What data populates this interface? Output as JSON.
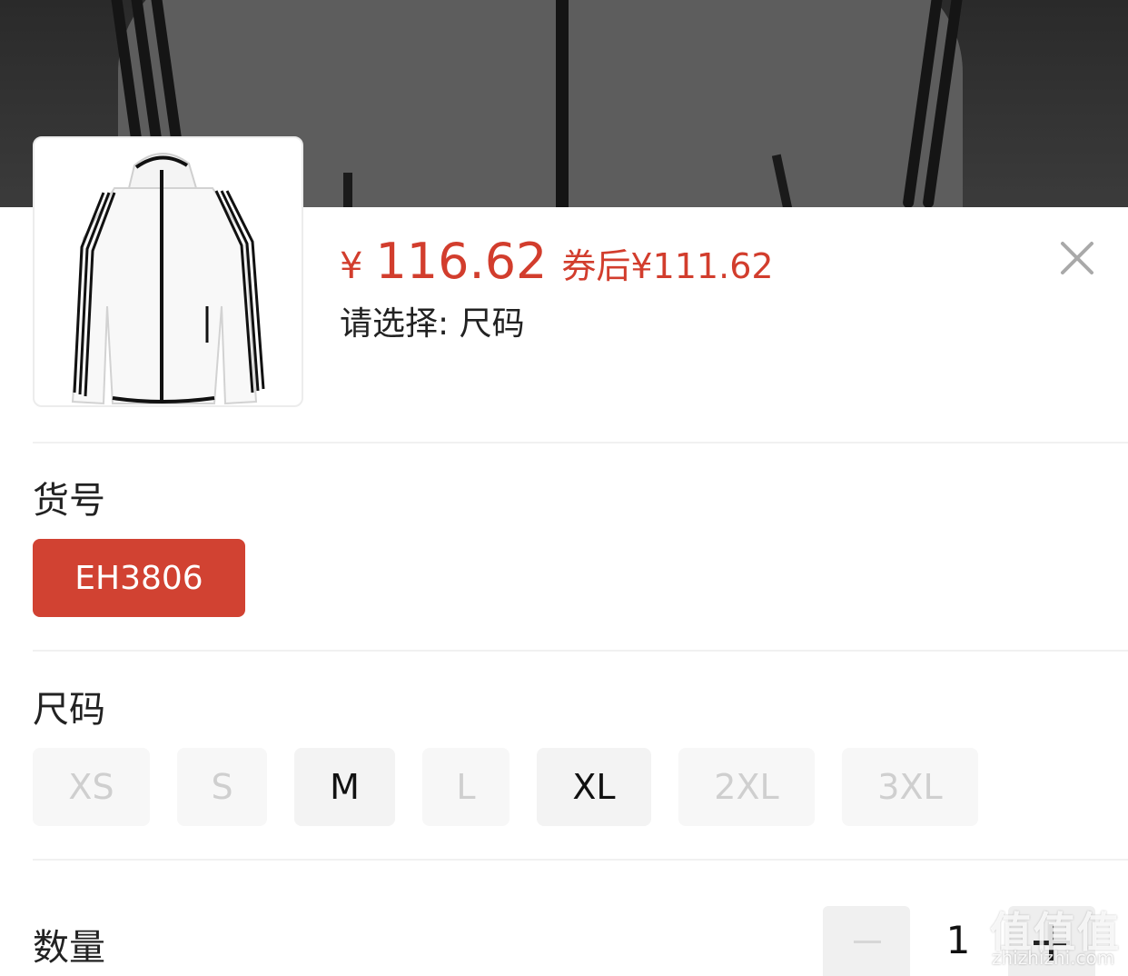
{
  "product": {
    "price_symbol": "¥",
    "price": "116.62",
    "coupon_price": "券后¥111.62",
    "select_hint": "请选择: 尺码",
    "image_icon": "white-jacket-product-image"
  },
  "sku": {
    "title": "货号",
    "options": [
      {
        "label": "EH3806",
        "selected": true
      }
    ]
  },
  "size": {
    "title": "尺码",
    "options": [
      {
        "label": "XS",
        "available": false
      },
      {
        "label": "S",
        "available": false
      },
      {
        "label": "M",
        "available": true
      },
      {
        "label": "L",
        "available": false
      },
      {
        "label": "XL",
        "available": true
      },
      {
        "label": "2XL",
        "available": false
      },
      {
        "label": "3XL",
        "available": false
      }
    ]
  },
  "quantity": {
    "title": "数量",
    "value": "1"
  },
  "watermark": {
    "logo": "值值值",
    "text": "zhizhizhi.com"
  },
  "colors": {
    "accent": "#d14232",
    "price": "#d23d2d",
    "disabled_text": "#cfcfcf"
  }
}
